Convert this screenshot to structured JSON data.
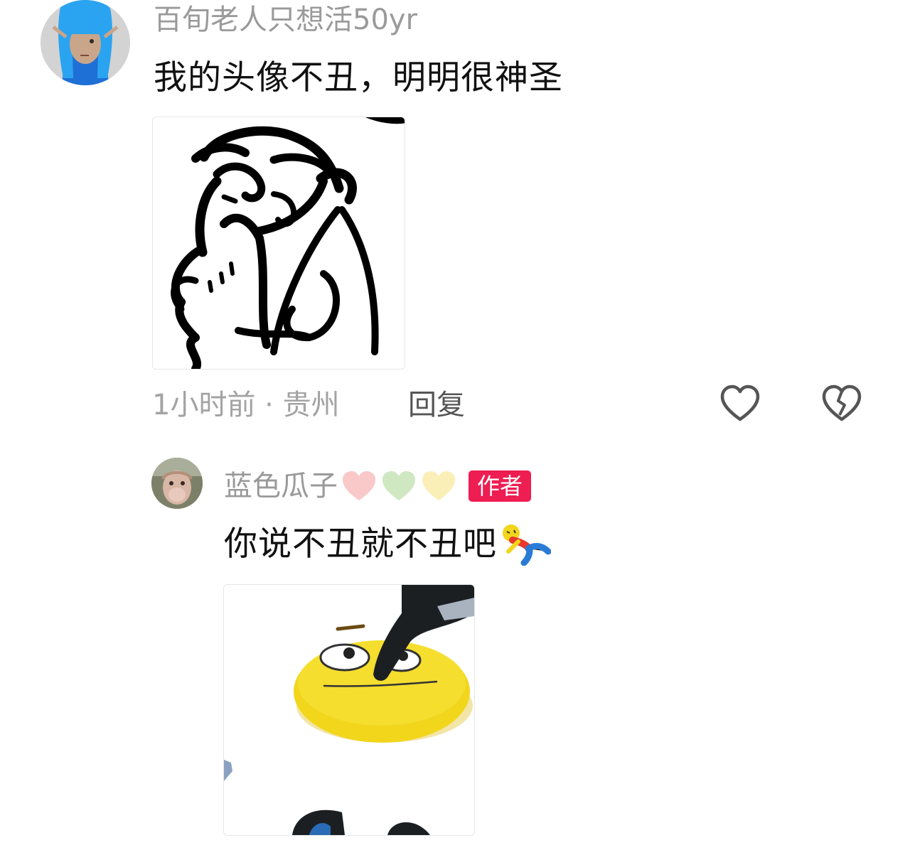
{
  "comments": [
    {
      "username": "百旬老人只想活50yr",
      "text": "我的头像不丑，明明很神圣",
      "time_location": "1小时前 · 贵州",
      "reply_label": "回复",
      "icons": {
        "avatar": "blue-haired-elf-avatar",
        "like": "heart-outline-icon",
        "dislike": "broken-heart-icon"
      }
    },
    {
      "username": "蓝色瓜子",
      "badge": "作者",
      "text": "你说不丑就不丑吧",
      "icons": {
        "avatar": "monkey-avatar",
        "name_hearts": [
          "pink-heart",
          "green-heart",
          "yellow-heart"
        ],
        "emoji": "fallen-person-emoji"
      }
    }
  ],
  "colors": {
    "badge": "#ee1d52",
    "username": "#9a9a9a",
    "meta": "#a3a3a3",
    "text": "#111111",
    "emoji_yellow": "#f2d61c"
  }
}
